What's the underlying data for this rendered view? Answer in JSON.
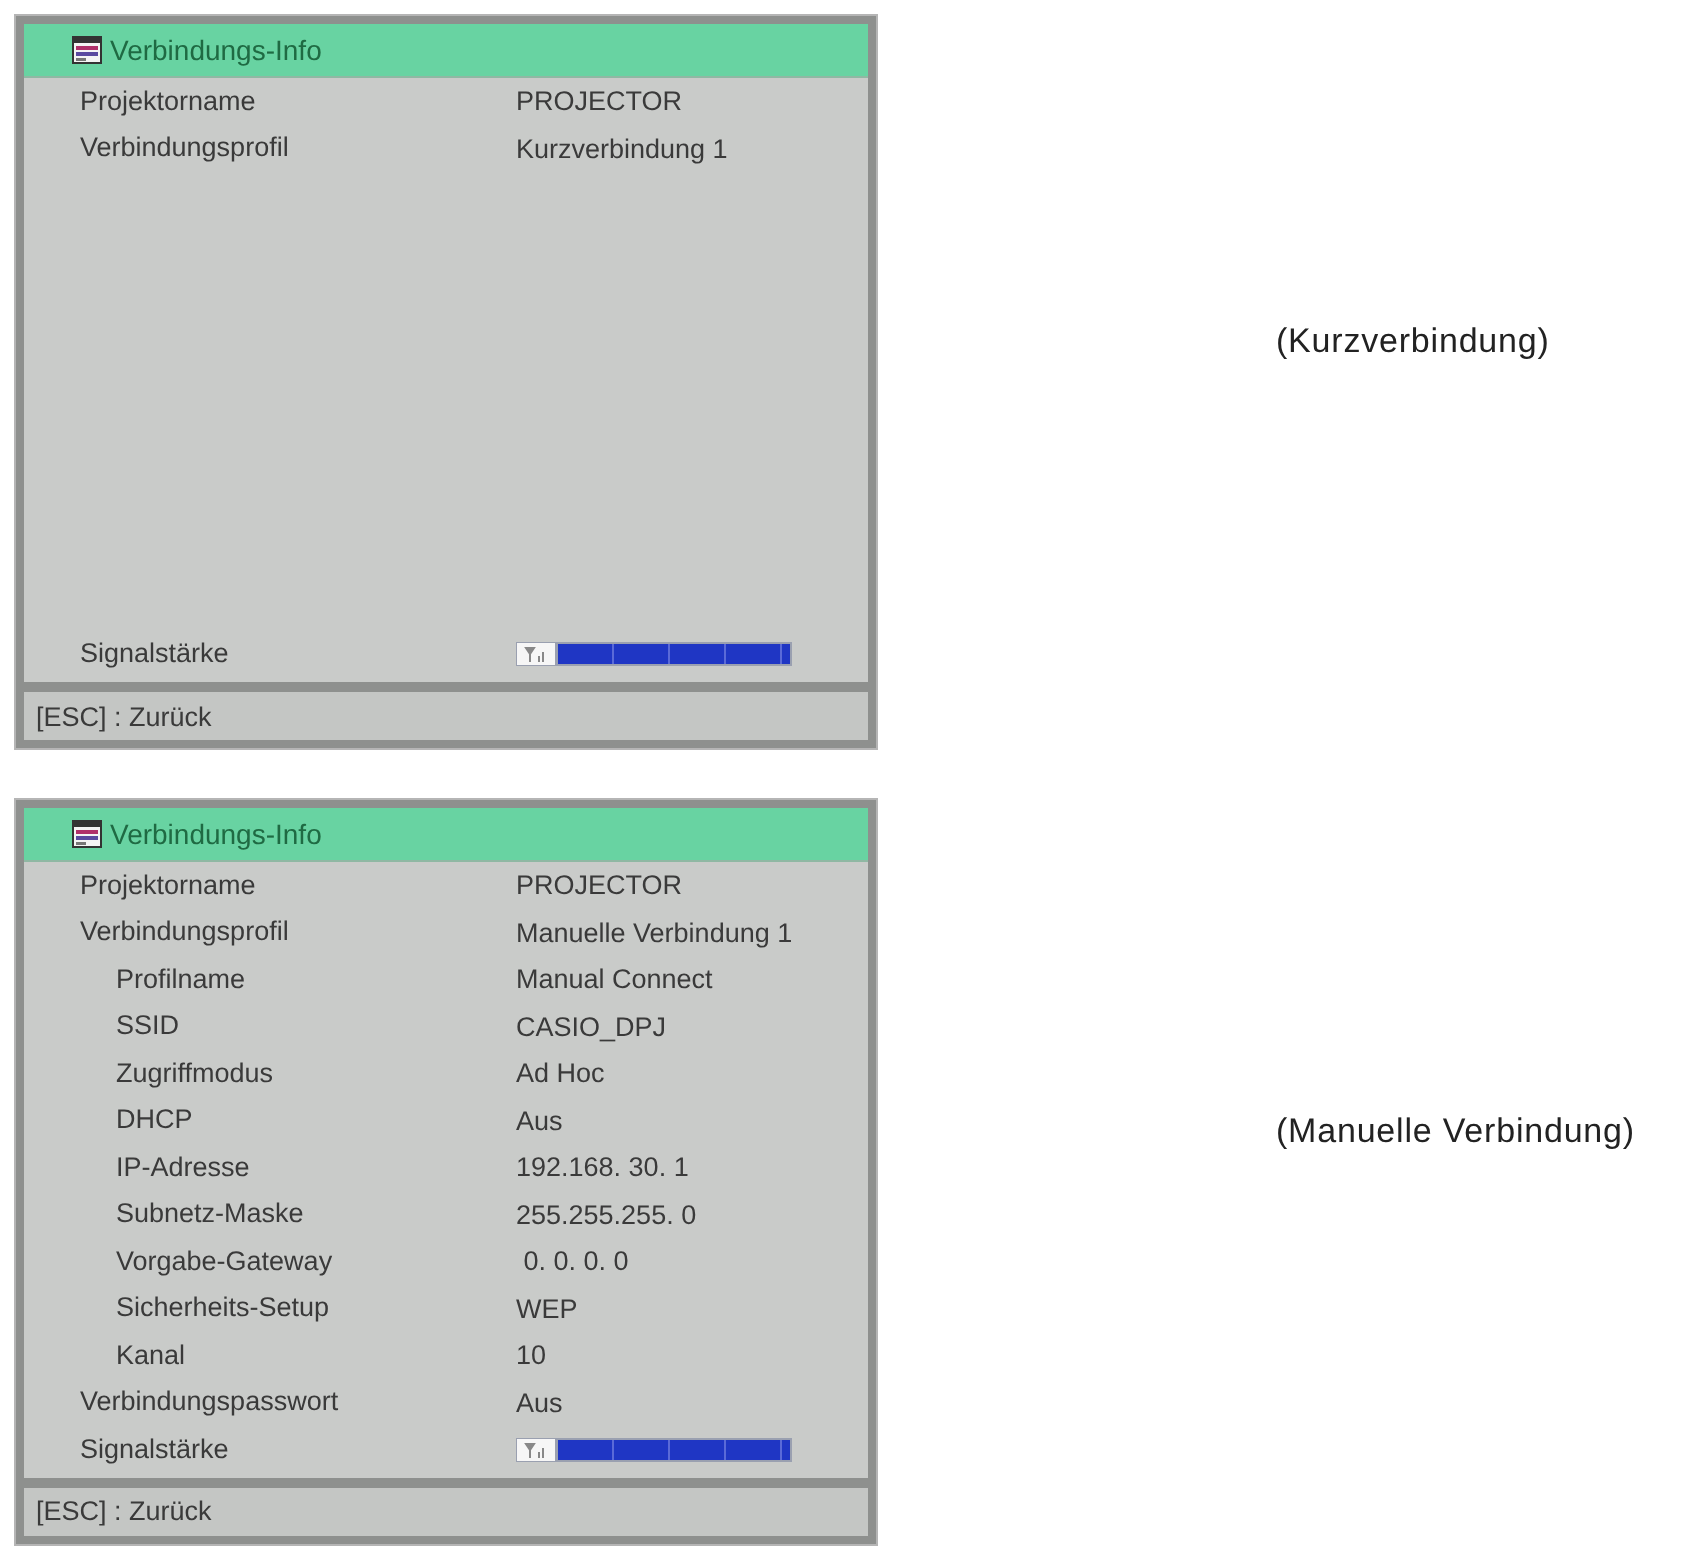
{
  "screens": [
    {
      "title": "Verbindungs-Info",
      "rows": [
        {
          "label": "Projektorname",
          "value": "PROJECTOR"
        },
        {
          "label": "Verbindungsprofil",
          "value": "Kurzverbindung 1"
        }
      ],
      "signal": {
        "label": "Signalstärke",
        "level": 1
      },
      "footer": "[ESC] : Zurück",
      "caption": "(Kurzverbindung)"
    },
    {
      "title": "Verbindungs-Info",
      "rows": [
        {
          "label": "Projektorname",
          "value": "PROJECTOR"
        },
        {
          "label": "Verbindungsprofil",
          "value": "Manuelle Verbindung 1",
          "children": [
            {
              "label": "Profilname",
              "value": "Manual Connect"
            },
            {
              "label": "SSID",
              "value": "CASIO_DPJ"
            },
            {
              "label": "Zugriffmodus",
              "value": "Ad Hoc"
            },
            {
              "label": "DHCP",
              "value": "Aus"
            },
            {
              "label": "IP-Adresse",
              "value": "192.168. 30. 1"
            },
            {
              "label": "Subnetz-Maske",
              "value": "255.255.255. 0"
            },
            {
              "label": "Vorgabe-Gateway",
              "value": " 0. 0. 0. 0"
            },
            {
              "label": "Sicherheits-Setup",
              "value": "WEP"
            },
            {
              "label": "Kanal",
              "value": "10"
            }
          ]
        },
        {
          "label": "Verbindungspasswort",
          "value": "Aus"
        }
      ],
      "signal": {
        "label": "Signalstärke",
        "level": 1
      },
      "footer": "[ESC] : Zurück",
      "caption": "(Manuelle Verbindung)"
    }
  ]
}
